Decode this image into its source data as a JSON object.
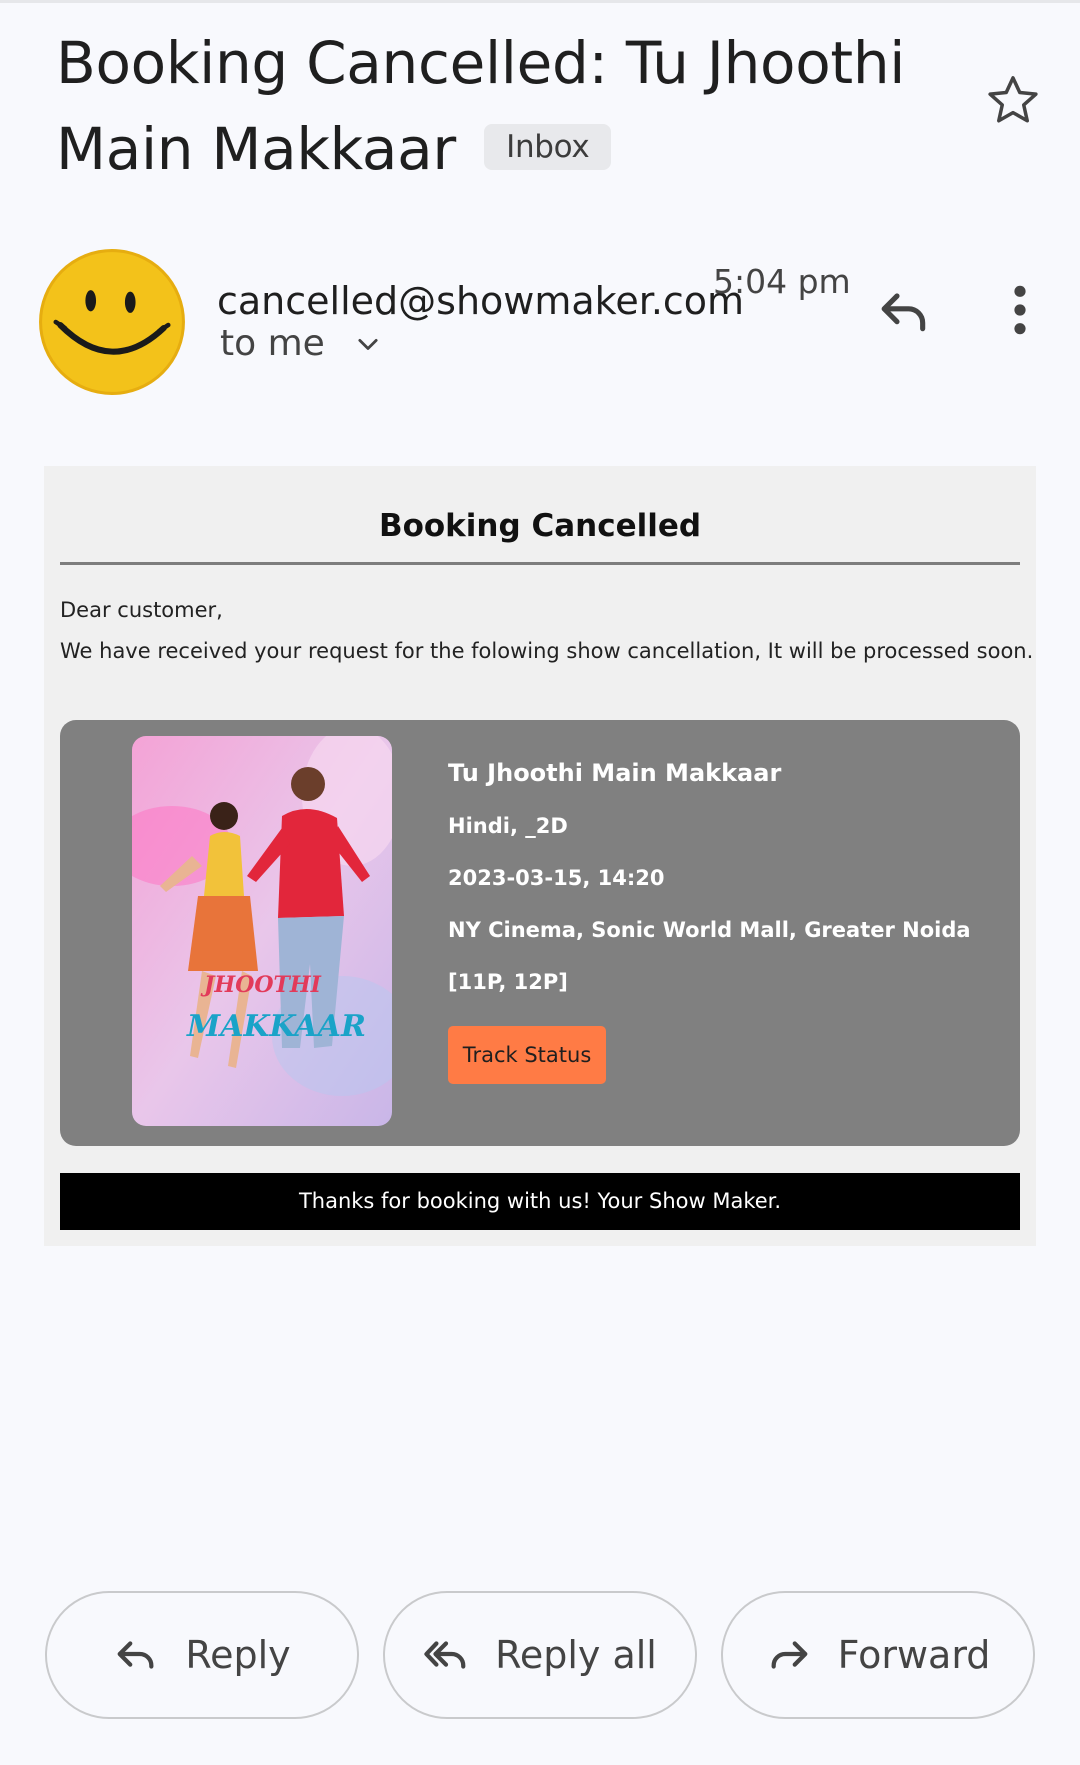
{
  "email": {
    "subject": "Booking Cancelled: Tu Jhoothi Main Makkaar",
    "label": "Inbox",
    "sender": "cancelled@showmaker.com",
    "recipient": "to me",
    "time": "5:04 pm"
  },
  "body": {
    "heading": "Booking Cancelled",
    "greeting": "Dear customer,",
    "message": "We have received your request for the folowing show cancellation, It will be processed soon.",
    "ticket": {
      "movie": "Tu Jhoothi Main Makkaar",
      "language_format": "Hindi, _2D",
      "datetime": "2023-03-15, 14:20",
      "venue": "NY Cinema, Sonic World Mall, Greater Noida",
      "seats": "[11P, 12P]",
      "button": "Track Status"
    },
    "footer": "Thanks for booking with us! Your Show Maker."
  },
  "actions": {
    "reply": "Reply",
    "reply_all": "Reply all",
    "forward": "Forward"
  },
  "colors": {
    "ticket_bg": "#808080",
    "button": "#ff7b45",
    "avatar": "#f3c21a"
  },
  "icons": [
    "star-icon",
    "smiley-avatar",
    "chevron-down-icon",
    "reply-icon",
    "more-vert-icon",
    "reply-all-icon",
    "forward-icon"
  ]
}
